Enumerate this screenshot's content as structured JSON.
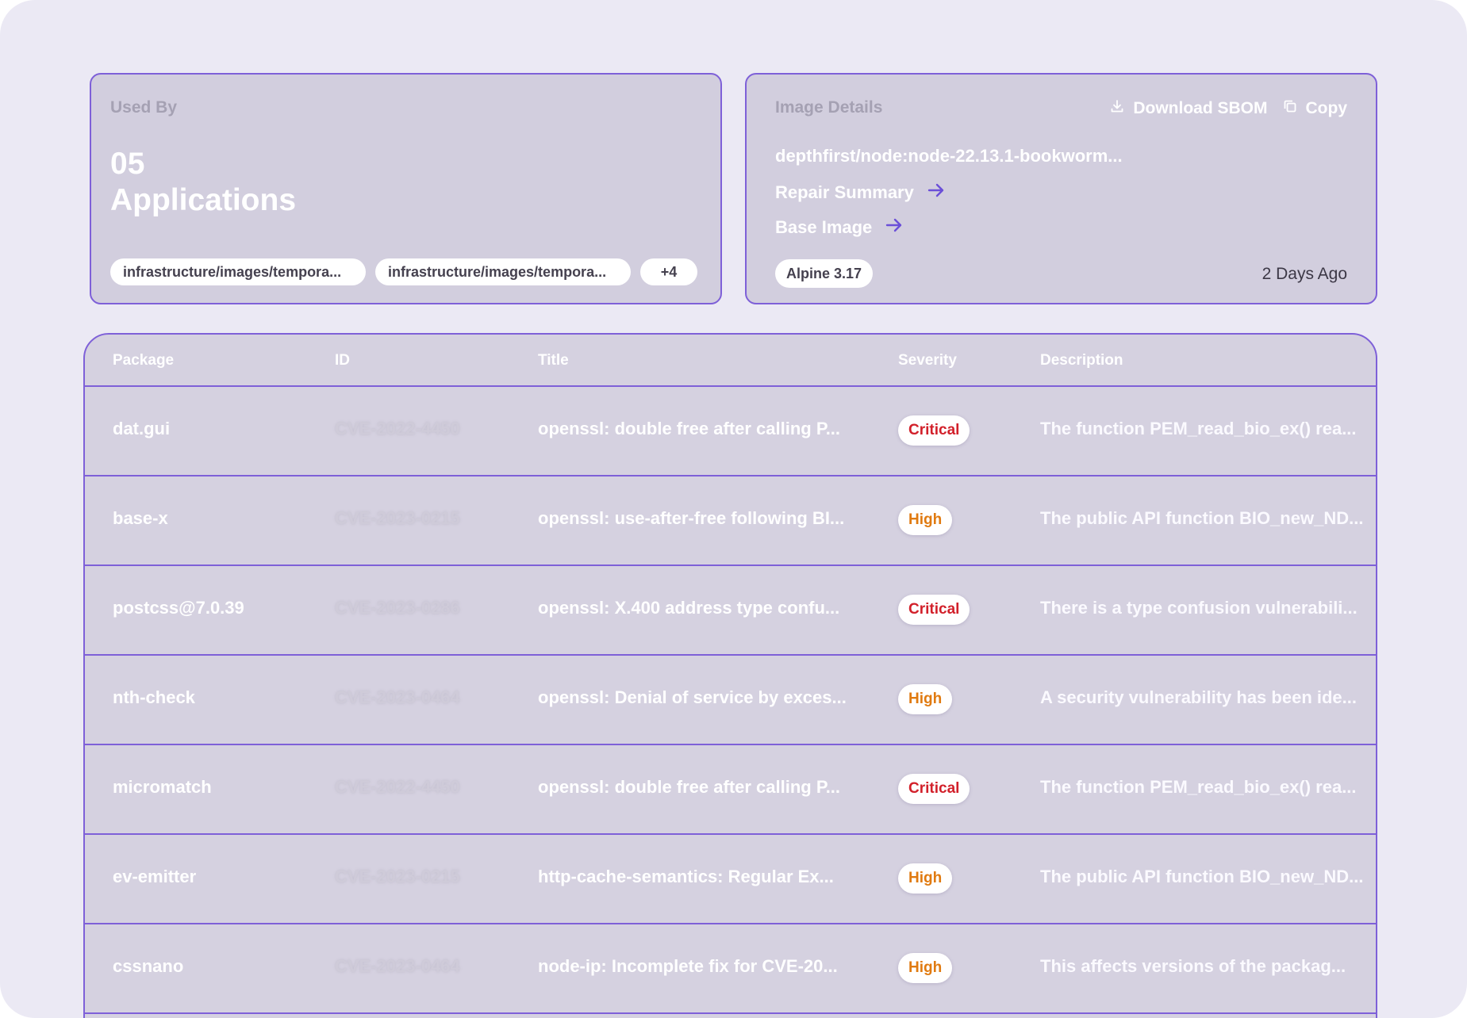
{
  "used_by": {
    "label": "Used By",
    "count": "05",
    "unit": "Applications",
    "chips": [
      "infrastructure/images/tempora...",
      "infrastructure/images/tempora..."
    ],
    "more": "+4"
  },
  "image_details": {
    "label": "Image Details",
    "download_label": "Download SBOM",
    "copy_label": "Copy",
    "image_name": "depthfirst/node:node-22.13.1-bookworm...",
    "repair_summary": "Repair Summary",
    "base_image": "Base Image",
    "os": "Alpine 3.17",
    "age": "2 Days Ago"
  },
  "table": {
    "headers": {
      "package": "Package",
      "id": "ID",
      "title": "Title",
      "severity": "Severity",
      "description": "Description"
    },
    "rows": [
      {
        "package": "dat.gui",
        "id": "CVE-2022-4450",
        "title": "openssl: double free after calling P...",
        "severity": "Critical",
        "description": "The function PEM_read_bio_ex() rea..."
      },
      {
        "package": "base-x",
        "id": "CVE-2023-0215",
        "title": "openssl: use-after-free following BI...",
        "severity": "High",
        "description": "The public API function BIO_new_ND..."
      },
      {
        "package": "postcss@7.0.39",
        "id": "CVE-2023-0286",
        "title": "openssl: X.400 address type confu...",
        "severity": "Critical",
        "description": "There is a type confusion vulnerabili..."
      },
      {
        "package": "nth-check",
        "id": "CVE-2023-0464",
        "title": "openssl: Denial of service by exces...",
        "severity": "High",
        "description": "A security vulnerability has been ide..."
      },
      {
        "package": "micromatch",
        "id": "CVE-2022-4450",
        "title": "openssl: double free after calling P...",
        "severity": "Critical",
        "description": "The function PEM_read_bio_ex() rea..."
      },
      {
        "package": "ev-emitter",
        "id": "CVE-2023-0215",
        "title": "http-cache-semantics: Regular Ex...",
        "severity": "High",
        "description": "The public API function BIO_new_ND..."
      },
      {
        "package": "cssnano",
        "id": "CVE-2023-0464",
        "title": "node-ip: Incomplete fix for CVE-20...",
        "severity": "High",
        "description": "This affects versions of the packag..."
      }
    ]
  },
  "colors": {
    "accent": "#7e60d8",
    "critical": "#d2202a",
    "high": "#e07a10"
  }
}
